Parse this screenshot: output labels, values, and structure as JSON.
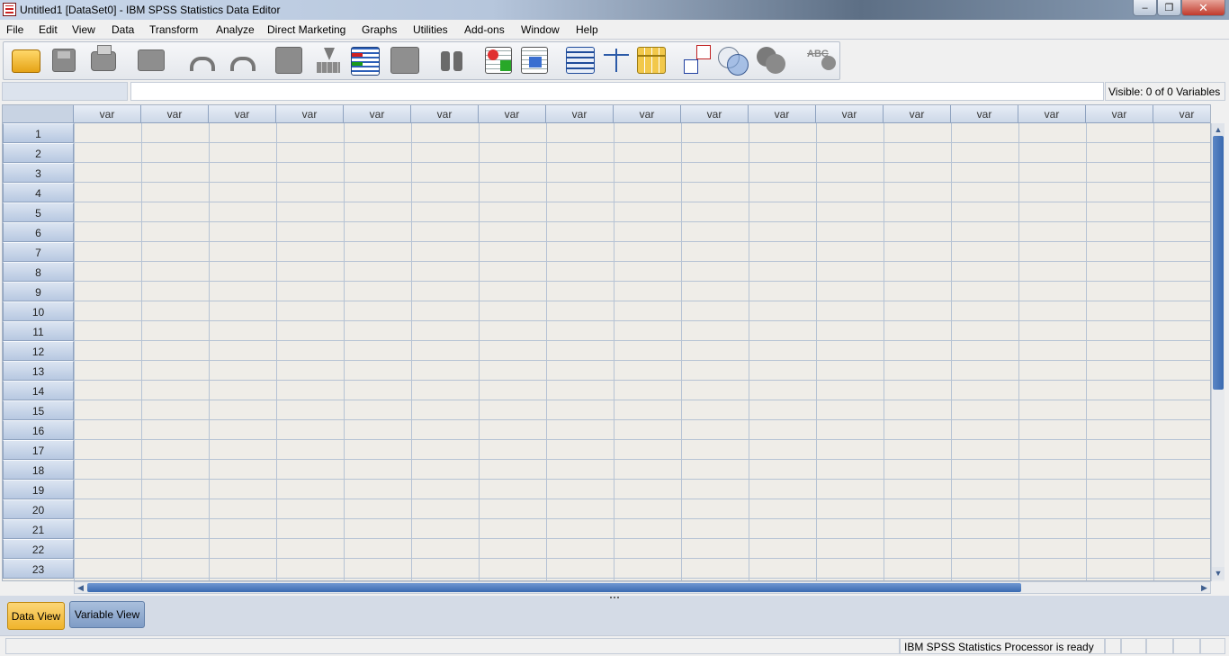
{
  "window": {
    "title": "Untitled1 [DataSet0] - IBM SPSS Statistics Data Editor",
    "minimize": "–",
    "maximize": "❐",
    "close": "✕"
  },
  "menu": [
    "File",
    "Edit",
    "View",
    "Data",
    "Transform",
    "Analyze",
    "Direct Marketing",
    "Graphs",
    "Utilities",
    "Add-ons",
    "Window",
    "Help"
  ],
  "toolbar": {
    "icons": [
      "open-data-icon",
      "save-icon",
      "print-icon",
      "recall-dialog-icon",
      "undo-icon",
      "redo-icon",
      "go-to-case-icon",
      "go-to-variable-icon",
      "variables-icon",
      "run-descriptives-icon",
      "find-icon",
      "insert-cases-icon",
      "insert-variable-icon",
      "split-file-icon",
      "weight-cases-icon",
      "select-cases-icon",
      "value-labels-icon",
      "use-variable-sets-icon",
      "show-all-variables-icon",
      "spell-check-icon"
    ],
    "spell_label": "ABC"
  },
  "cell_editor": {
    "cell_reference": "",
    "value": "",
    "visible_label": "Visible: 0 of 0 Variables"
  },
  "grid": {
    "column_header": "var",
    "column_count": 17,
    "rows": [
      "1",
      "2",
      "3",
      "4",
      "5",
      "6",
      "7",
      "8",
      "9",
      "10",
      "11",
      "12",
      "13",
      "14",
      "15",
      "16",
      "17",
      "18",
      "19",
      "20",
      "21",
      "22",
      "23"
    ]
  },
  "tabs": {
    "data_view": "Data View",
    "variable_view": "Variable View",
    "active": "Data View"
  },
  "status": {
    "processor": "IBM SPSS Statistics Processor is ready"
  },
  "colors": {
    "active_tab": "#f0b42c",
    "inactive_tab": "#7f9cc6",
    "header_blue": "#b7c8e1",
    "scroll_thumb": "#3a6ab0",
    "close_button": "#c0392b"
  }
}
